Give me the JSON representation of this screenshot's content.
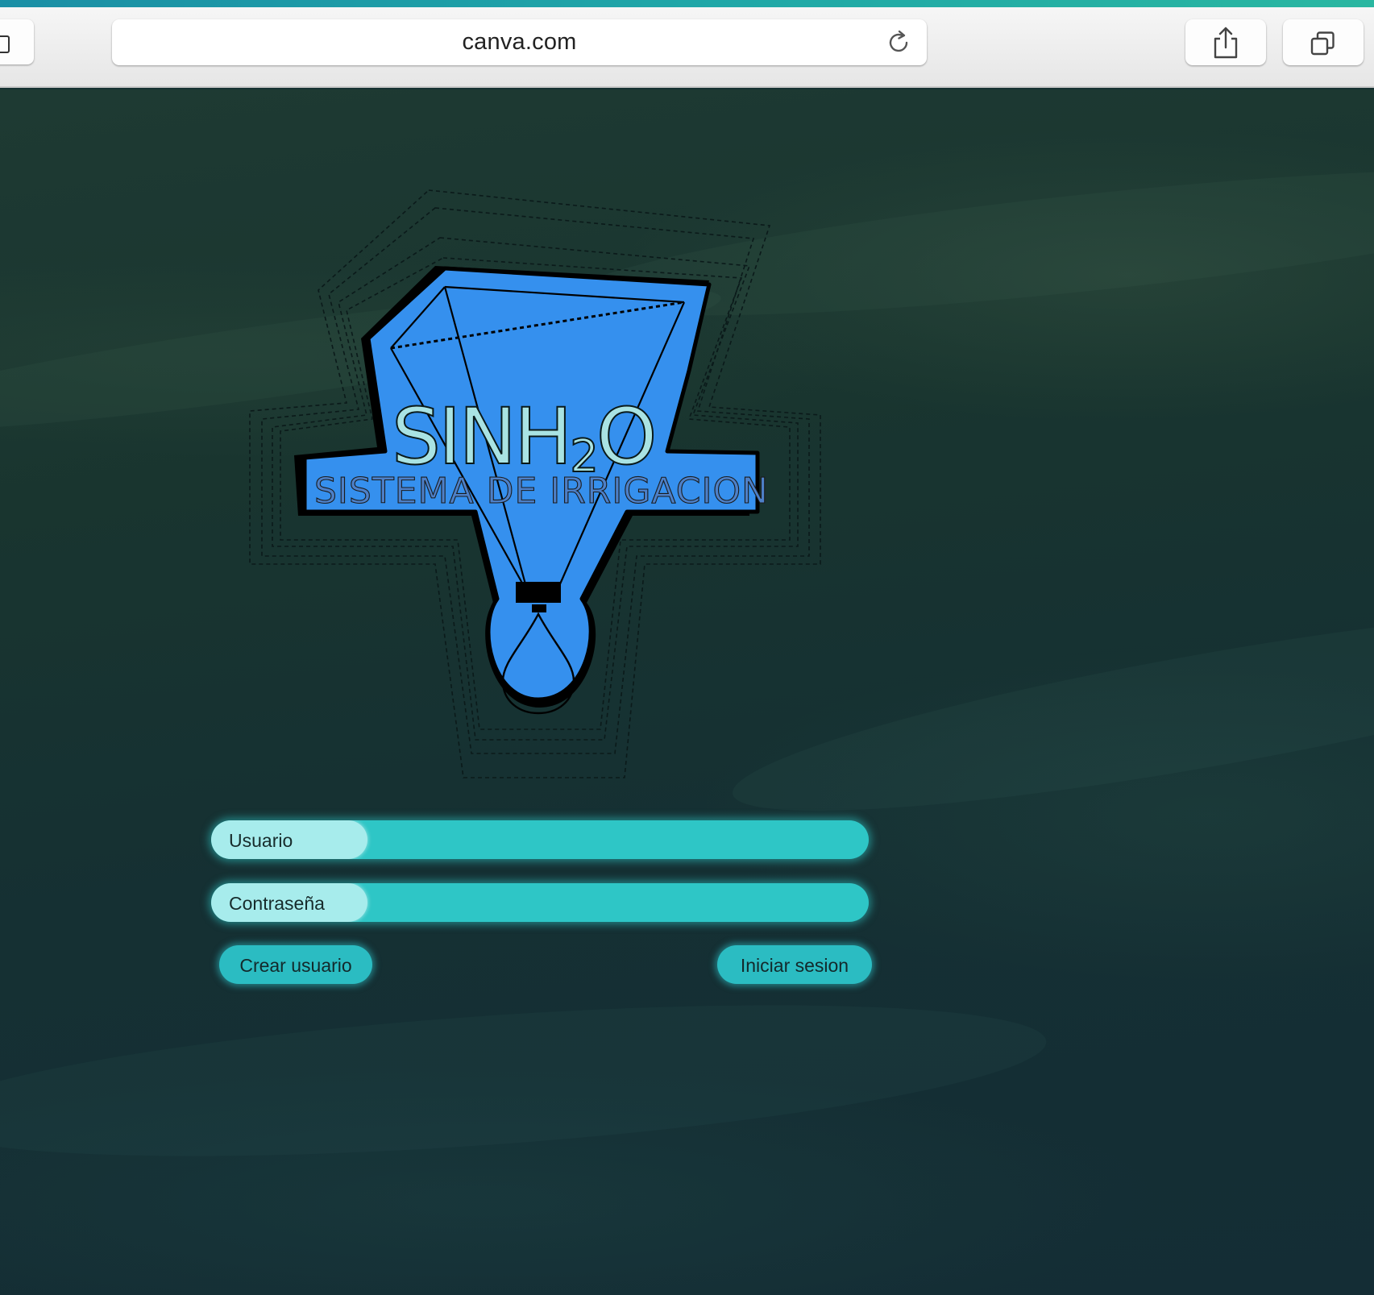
{
  "browser": {
    "url_text": "canva.com",
    "icons": {
      "reload": "reload-icon",
      "share": "share-icon",
      "tabs": "tabs-icon"
    }
  },
  "logo": {
    "title_main": "SINH",
    "title_sub": "2",
    "title_end": "O",
    "subtitle": "SISTEMA DE IRRIGACION"
  },
  "form": {
    "username_label": "Usuario",
    "password_label": "Contraseña",
    "create_button": "Crear usuario",
    "login_button": "Iniciar sesion"
  },
  "colors": {
    "accent": "#2ec6c6",
    "logo_blue": "#3590ee",
    "label_pill": "#a7ecec",
    "background": "#163131"
  }
}
